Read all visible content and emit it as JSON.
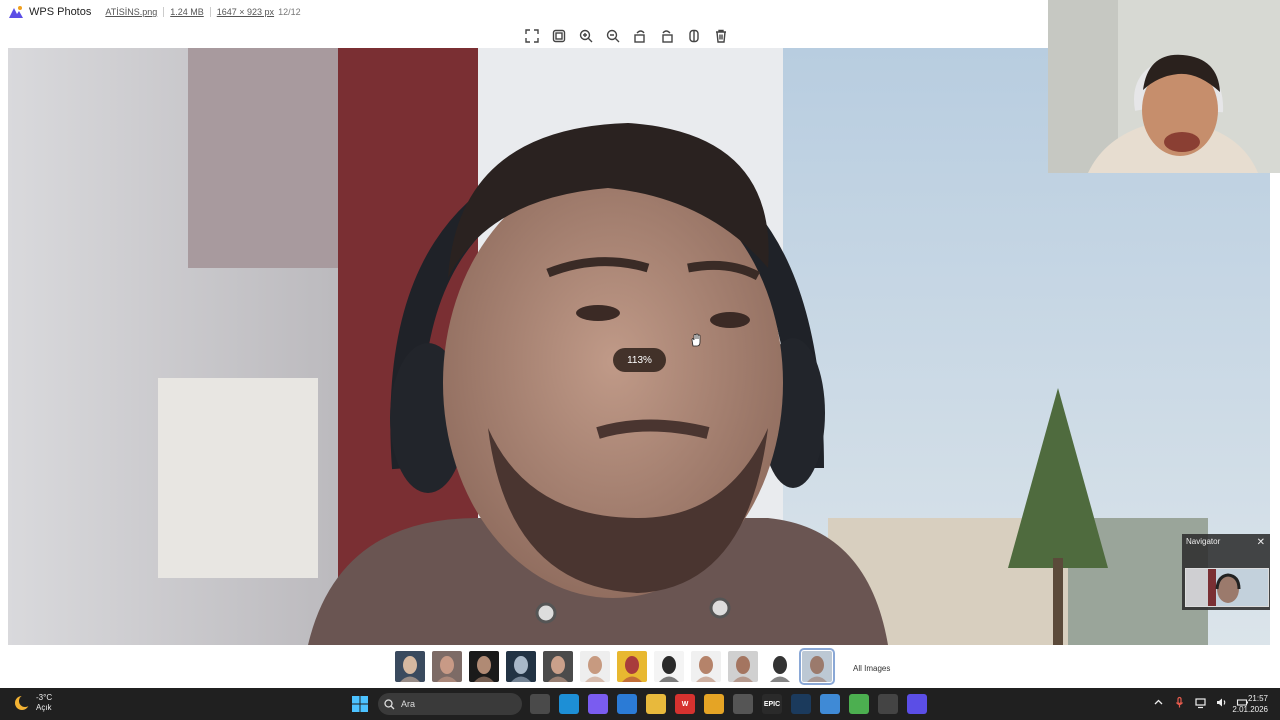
{
  "app": {
    "name": "WPS Photos",
    "brand_color": "#5b4ee6"
  },
  "file": {
    "name": "ATİSİNS.png",
    "size": "1.24 MB",
    "dimensions": "1647 × 923 px",
    "index": "12/12"
  },
  "toolbar": {
    "buttons": [
      {
        "name": "fullscreen-icon"
      },
      {
        "name": "fit-window-icon"
      },
      {
        "name": "zoom-in-icon"
      },
      {
        "name": "zoom-out-icon"
      },
      {
        "name": "rotate-left-icon"
      },
      {
        "name": "rotate-right-icon"
      },
      {
        "name": "mirror-icon"
      },
      {
        "name": "delete-icon"
      }
    ]
  },
  "viewer": {
    "zoom_label": "113%"
  },
  "navigator": {
    "title": "Navigator",
    "close_glyph": "✕"
  },
  "filmstrip": {
    "thumbnail_count": 12,
    "selected_index": 12,
    "all_images_label": "All Images"
  },
  "taskbar": {
    "weather": {
      "temp": "-3°C",
      "condition": "Açık"
    },
    "search_placeholder": "Ara",
    "apps": [
      {
        "name": "task-view-icon",
        "color": "#4a4a4a",
        "glyph": ""
      },
      {
        "name": "edge-icon",
        "color": "#1d8fd6",
        "glyph": ""
      },
      {
        "name": "copilot-icon",
        "color": "#7a5cf0",
        "glyph": ""
      },
      {
        "name": "store-icon",
        "color": "#2b7bd6",
        "glyph": ""
      },
      {
        "name": "file-explorer-icon",
        "color": "#e8b93c",
        "glyph": ""
      },
      {
        "name": "wps-office-icon",
        "color": "#d6322f",
        "glyph": "W"
      },
      {
        "name": "chrome-icon",
        "color": "#e5a425",
        "glyph": ""
      },
      {
        "name": "settings-icon",
        "color": "#555",
        "glyph": ""
      },
      {
        "name": "epic-games-icon",
        "color": "#2a2a2a",
        "glyph": "EPIC"
      },
      {
        "name": "steam-icon",
        "color": "#1b3a5c",
        "glyph": ""
      },
      {
        "name": "notepad-icon",
        "color": "#3f8ad6",
        "glyph": ""
      },
      {
        "name": "battery-app-icon",
        "color": "#4caf50",
        "glyph": ""
      },
      {
        "name": "obs-icon",
        "color": "#444",
        "glyph": ""
      },
      {
        "name": "wps-photos-icon",
        "color": "#5b4ee6",
        "glyph": ""
      }
    ],
    "clock": {
      "time": "21:57",
      "date": "2.01.2026"
    }
  }
}
